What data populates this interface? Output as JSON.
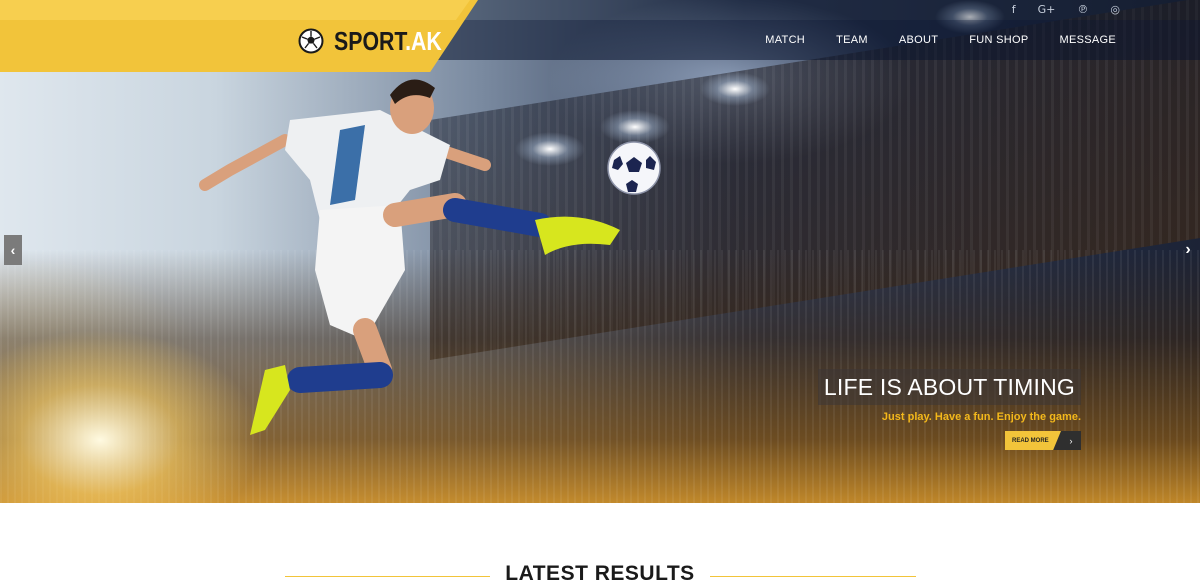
{
  "brand": {
    "name_main": "SPORT",
    "name_accent": ".AK",
    "logo_icon": "soccer-ball-icon"
  },
  "social": [
    {
      "icon": "facebook-icon",
      "glyph": "f"
    },
    {
      "icon": "google-plus-icon",
      "glyph": "G+"
    },
    {
      "icon": "pinterest-icon",
      "glyph": "℗"
    },
    {
      "icon": "instagram-icon",
      "glyph": "◎"
    }
  ],
  "nav": {
    "items": [
      "MATCH",
      "TEAM",
      "ABOUT",
      "FUN SHOP",
      "MESSAGE"
    ]
  },
  "slider": {
    "prev_glyph": "‹",
    "next_glyph": "›",
    "title": "LIFE IS ABOUT TIMING",
    "subtitle": "Just play. Have a fun. Enjoy the game.",
    "button_label": "READ MORE",
    "button_arrow": "›"
  },
  "results": {
    "title": "LATEST RESULTS"
  },
  "colors": {
    "accent": "#f2c43a",
    "caption_subtitle": "#f3b81b",
    "nav_text": "#ffffff"
  }
}
